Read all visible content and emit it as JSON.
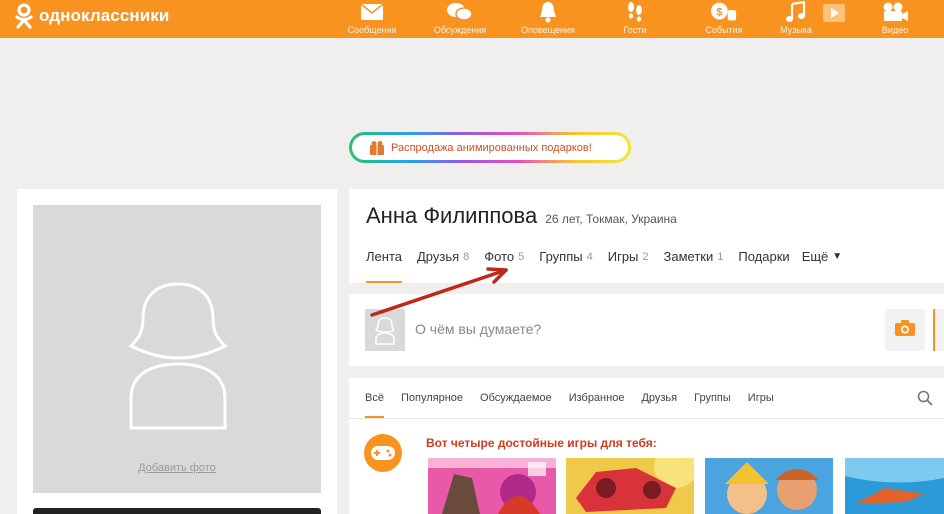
{
  "app": {
    "logo_text": "одноклассники"
  },
  "nav": [
    {
      "label": "Сообщения",
      "icon": "envelope-icon"
    },
    {
      "label": "Обсуждения",
      "icon": "chat-bubbles-icon"
    },
    {
      "label": "Оповещения",
      "icon": "bell-icon"
    },
    {
      "label": "Гости",
      "icon": "footprints-icon"
    },
    {
      "label": "События",
      "icon": "coin-hand-icon"
    },
    {
      "label": "Музыка",
      "icon": "music-note-icon"
    },
    {
      "label": "Видео",
      "icon": "video-camera-icon"
    }
  ],
  "promo": {
    "text": "Распродажа анимированных подарков!",
    "icon": "gift-icon"
  },
  "left": {
    "add_photo": "Добавить фото"
  },
  "profile": {
    "name": "Анна Филиппова",
    "meta": "26 лет, Токмак, Украина",
    "tabs": [
      {
        "label": "Лента",
        "count": ""
      },
      {
        "label": "Друзья",
        "count": "8"
      },
      {
        "label": "Фото",
        "count": "5"
      },
      {
        "label": "Группы",
        "count": "4"
      },
      {
        "label": "Игры",
        "count": "2"
      },
      {
        "label": "Заметки",
        "count": "1"
      },
      {
        "label": "Подарки",
        "count": ""
      },
      {
        "label": "Ещё",
        "count": ""
      }
    ]
  },
  "post": {
    "placeholder": "О чём вы думаете?"
  },
  "feed": {
    "tabs": [
      "Всё",
      "Популярное",
      "Обсуждаемое",
      "Избранное",
      "Друзья",
      "Группы",
      "Игры"
    ],
    "games_title": "Вот четыре достойные игры для тебя:"
  },
  "colors": {
    "brand": "#f7931e",
    "accent_red": "#d03a1e"
  }
}
